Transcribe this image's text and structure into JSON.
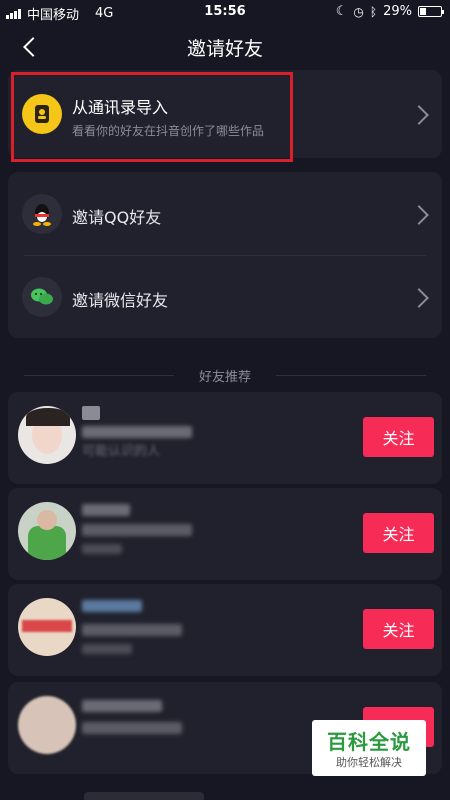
{
  "status": {
    "carrier": "中国移动",
    "network": "4G",
    "time": "15:56",
    "battery_text": "29%",
    "battery_level": 0.29
  },
  "nav": {
    "title": "邀请好友"
  },
  "contacts": {
    "title": "从通讯录导入",
    "subtitle": "看看你的好友在抖音创作了哪些作品"
  },
  "invite": {
    "qq_label": "邀请QQ好友",
    "wechat_label": "邀请微信好友"
  },
  "recommend": {
    "section_title": "好友推荐",
    "follow_label": "关注",
    "first_hint": "可能认识的人"
  },
  "watermark": {
    "line1": "百科全说",
    "line2": "助你轻松解决"
  },
  "colors": {
    "accent": "#f62b56",
    "highlight": "#d8202a",
    "background": "#161722",
    "card": "#20212c"
  }
}
